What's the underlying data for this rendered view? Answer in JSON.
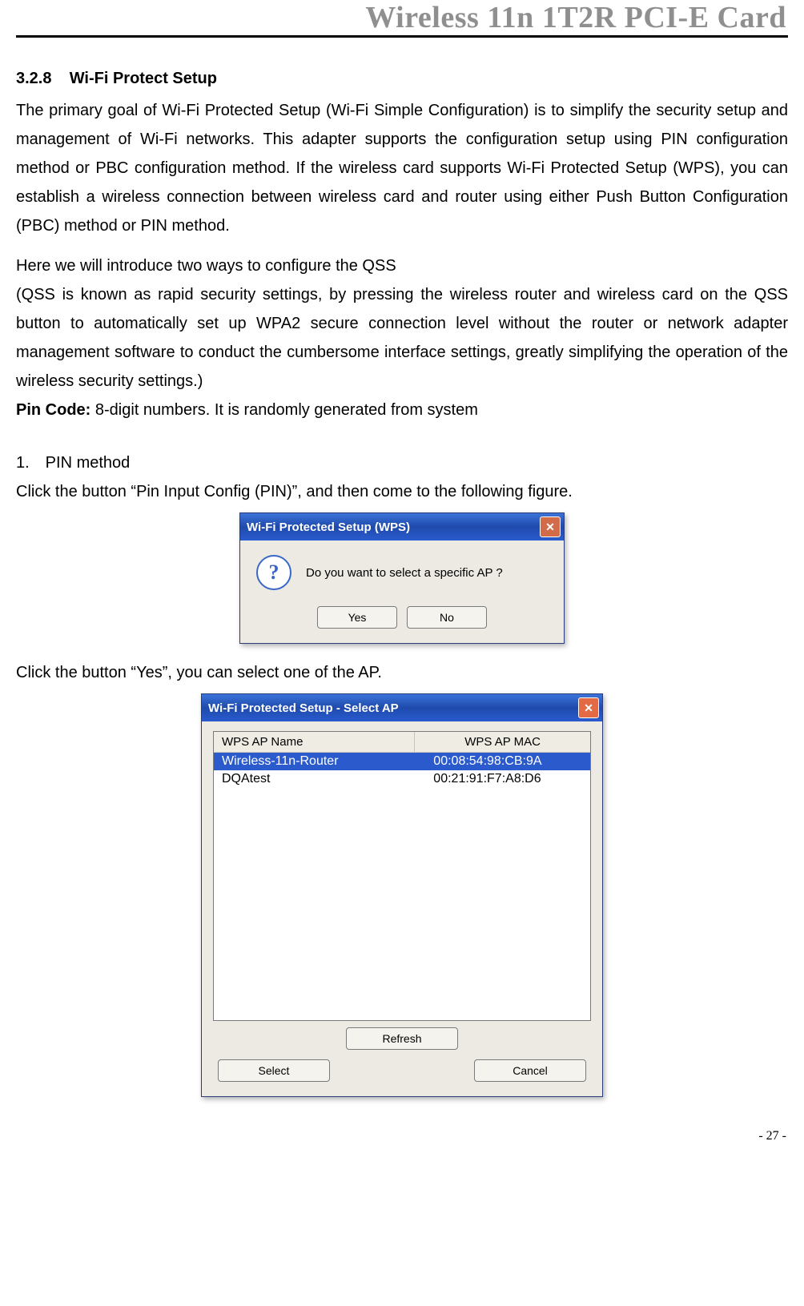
{
  "header": "Wireless 11n 1T2R PCI-E Card",
  "section": {
    "number": "3.2.8",
    "title": "Wi-Fi Protect Setup"
  },
  "para1": "The primary goal of Wi-Fi Protected Setup (Wi-Fi Simple Configuration) is to simplify the security setup and management of Wi-Fi networks. This adapter supports the configuration setup using PIN configuration method or PBC configuration method. If the wireless card supports Wi-Fi Protected Setup (WPS), you can establish a wireless connection between wireless card and router using either Push Button Configuration (PBC) method or PIN method.",
  "para2": "Here we will introduce two ways to configure the QSS",
  "para3": "(QSS is known as rapid security settings, by pressing the wireless router and wireless card on the QSS button to automatically set up WPA2 secure connection level without the router or network adapter management software to conduct the cumbersome interface settings, greatly simplifying the operation of the wireless security settings.)",
  "pin_code_label": "Pin Code:",
  "pin_code_text": " 8-digit numbers. It is randomly generated from system",
  "list1_item": "1. PIN method",
  "para4": "Click the button “Pin Input Config (PIN)”, and then come to the following figure.",
  "dialog1": {
    "title": "Wi-Fi Protected Setup (WPS)",
    "message": "Do you want to select a specific AP ?",
    "yes": "Yes",
    "no": "No"
  },
  "para5": "Click the button “Yes”, you can select one of the AP.",
  "dialog2": {
    "title": "Wi-Fi Protected Setup - Select AP",
    "col_name": "WPS AP Name",
    "col_mac": "WPS AP MAC",
    "rows": [
      {
        "name": "Wireless-11n-Router",
        "mac": "00:08:54:98:CB:9A",
        "selected": true
      },
      {
        "name": "DQAtest",
        "mac": "00:21:91:F7:A8:D6",
        "selected": false
      }
    ],
    "refresh": "Refresh",
    "select": "Select",
    "cancel": "Cancel"
  },
  "page_number": "- 27 -"
}
